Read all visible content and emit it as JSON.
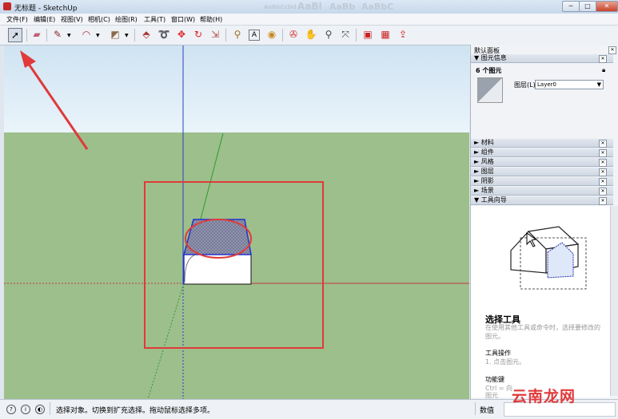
{
  "window": {
    "title": "无标题 - SketchUp",
    "minimize": "─",
    "maximize": "□",
    "close": "✕"
  },
  "ribbon_ghost": [
    "AaBbCcDd",
    "AaBl",
    "AaBb",
    "AaBbC"
  ],
  "menu": [
    "文件(F)",
    "编辑(E)",
    "视图(V)",
    "相机(C)",
    "绘图(R)",
    "工具(T)",
    "窗口(W)",
    "帮助(H)"
  ],
  "toolbar": {
    "tools": [
      {
        "name": "select-tool",
        "glyph": "➚"
      },
      {
        "name": "eraser-tool",
        "glyph": "▰"
      },
      {
        "name": "pencil-tool",
        "glyph": "✎"
      },
      {
        "name": "arc-tool",
        "glyph": "◠"
      },
      {
        "name": "rectangle-tool",
        "glyph": "◩"
      },
      {
        "name": "push-pull-tool",
        "glyph": "⬘"
      },
      {
        "name": "follow-me-tool",
        "glyph": "➰"
      },
      {
        "name": "move-tool",
        "glyph": "✥"
      },
      {
        "name": "rotate-tool",
        "glyph": "↻"
      },
      {
        "name": "scale-tool",
        "glyph": "⇲"
      },
      {
        "name": "tape-measure-tool",
        "glyph": "⚲"
      },
      {
        "name": "text-tool",
        "glyph": "A"
      },
      {
        "name": "paint-bucket-tool",
        "glyph": "◉"
      },
      {
        "name": "orbit-tool",
        "glyph": "✇"
      },
      {
        "name": "pan-tool",
        "glyph": "✋"
      },
      {
        "name": "zoom-tool",
        "glyph": "⚲"
      },
      {
        "name": "zoom-extents-tool",
        "glyph": "⤧"
      },
      {
        "name": "3d-warehouse-tool",
        "glyph": "▣"
      },
      {
        "name": "extension-warehouse-tool",
        "glyph": "▦"
      },
      {
        "name": "share-model-tool",
        "glyph": "⇪"
      }
    ]
  },
  "tray": {
    "title": "默认面板",
    "entity_info": {
      "header": "图元信息",
      "count": "6 个图元",
      "layer_label": "图层(L):",
      "layer_value": "Layer0"
    },
    "sections": [
      "材料",
      "组件",
      "风格",
      "图层",
      "阴影",
      "场景"
    ],
    "instructor": {
      "header": "工具向导",
      "tool_title": "选择工具",
      "tool_desc": "在使用其他工具或命令时，选择要修改的图元。",
      "ops_title": "工具操作",
      "ops_text": "1. 点击图元。",
      "keys_title": "功能键",
      "keys_text": "Ctrl = 向",
      "keys_text2": "图元"
    }
  },
  "status": {
    "hint": "选择对象。切换到扩充选择。拖动鼠标选择多项。",
    "measure_label": "数值"
  },
  "watermark": "云南龙网",
  "colors": {
    "annotation": "#e03a3a",
    "sky": "#dcecf7",
    "ground": "#9dbf8c",
    "axis_red": "#c43b3b",
    "axis_green": "#2e9a2e",
    "axis_blue": "#2b3fc4"
  }
}
